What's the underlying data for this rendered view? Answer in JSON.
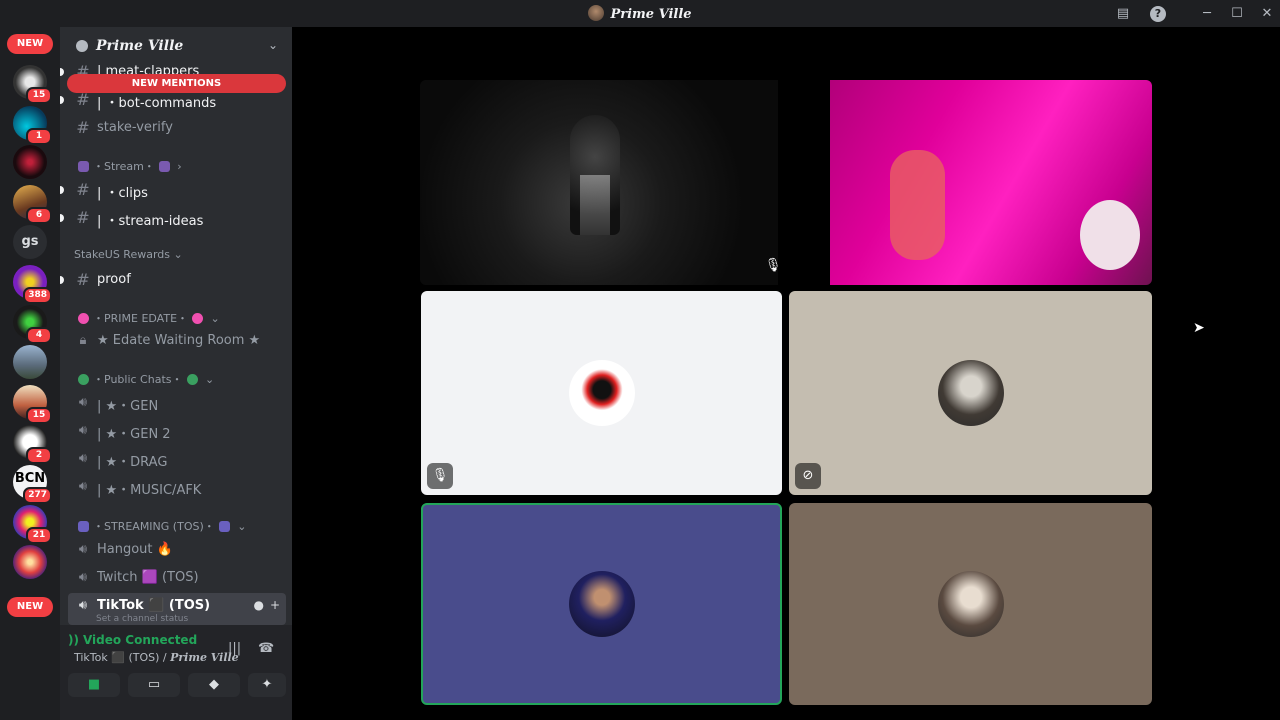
{
  "app": {
    "title": "Prime Ville"
  },
  "servers": {
    "top_pill": "NEW",
    "bottom_pill": "NEW",
    "items": [
      {
        "icon": "server-icon",
        "badge": "15"
      },
      {
        "icon": "server-icon",
        "badge": "1"
      },
      {
        "icon": "server-icon",
        "badge": ""
      },
      {
        "icon": "server-icon",
        "badge": "6"
      },
      {
        "icon": "server-icon",
        "label": "gs",
        "badge": ""
      },
      {
        "icon": "server-icon",
        "badge": "388"
      },
      {
        "icon": "server-icon",
        "badge": "4"
      },
      {
        "icon": "server-icon",
        "badge": ""
      },
      {
        "icon": "server-icon",
        "badge": "15"
      },
      {
        "icon": "server-icon",
        "badge": "2"
      },
      {
        "icon": "server-icon",
        "label": "BCN",
        "badge": "277"
      },
      {
        "icon": "server-icon",
        "badge": "21"
      },
      {
        "icon": "server-icon",
        "badge": ""
      }
    ]
  },
  "sidebar": {
    "guild_name": "Prime Ville",
    "new_mentions": "NEW MENTIONS",
    "channels": {
      "meat_clappers": "| meat-clappers",
      "bot_commands": "| ・bot-commands",
      "stake_verify": "stake-verify",
      "cat_stream": "・Stream・",
      "clips": "| ・clips",
      "stream_ideas": "| ・stream-ideas",
      "cat_stakeus": "StakeUS Rewards",
      "proof": "proof",
      "cat_prime_edate": "・PRIME EDATE・",
      "edate_waiting": "★ Edate Waiting Room ★",
      "cat_public": "・Public Chats・",
      "gen": "| ★・GEN",
      "gen2": "| ★・GEN 2",
      "drag": "| ★・DRAG",
      "music_afk": "| ★・MUSIC/AFK",
      "cat_streaming": "・STREAMING (TOS)・",
      "hangout": "Hangout 🔥",
      "twitch": "Twitch 🟪 (TOS)",
      "tiktok": "TikTok ⬛ (TOS)",
      "tiktok_sub": "Set a channel status"
    }
  },
  "voice": {
    "status": "Video Connected",
    "channel": "TikTok ⬛ (TOS) / ",
    "server": "Prime Ville"
  },
  "stage": {
    "tiles": [
      {
        "kind": "video",
        "muted": true
      },
      {
        "kind": "video",
        "muted": false
      },
      {
        "kind": "avatar",
        "muted": true
      },
      {
        "kind": "avatar",
        "muted": true
      },
      {
        "kind": "avatar",
        "muted": false,
        "speaking": true
      },
      {
        "kind": "avatar",
        "muted": false
      }
    ]
  },
  "colors": {
    "accent_green": "#23a55a",
    "badge_red": "#f23f43",
    "speaking_tile": "#494c8c"
  }
}
